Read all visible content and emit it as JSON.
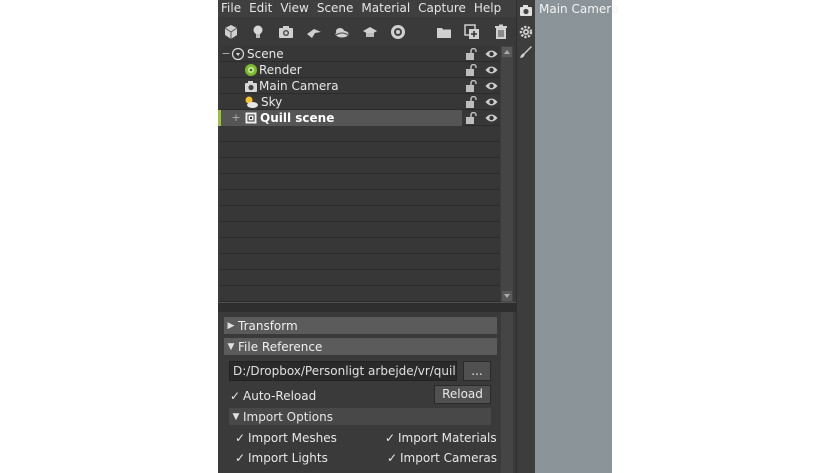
{
  "menu": [
    "File",
    "Edit",
    "View",
    "Scene",
    "Material",
    "Capture",
    "Help"
  ],
  "toolbar_icons": [
    "cube-icon",
    "light-bulb-icon",
    "camera-icon",
    "plane-icon",
    "sky-icon",
    "cap-icon",
    "disc-icon",
    "folder-icon",
    "new-layer-icon",
    "trash-icon"
  ],
  "tree": {
    "root": "Scene",
    "items": [
      "Render",
      "Main Camera",
      "Sky",
      "Quill scene"
    ]
  },
  "properties": {
    "transform_label": "Transform",
    "file_reference_label": "File Reference",
    "path_value": "D:/Dropbox/Personligt arbejde/vr/quillby.f",
    "browse_label": "...",
    "auto_reload_label": "Auto-Reload",
    "reload_label": "Reload",
    "import_options_label": "Import Options",
    "import_meshes": "Import Meshes",
    "import_materials": "Import Materials",
    "import_lights": "Import Lights",
    "import_cameras": "Import Cameras"
  },
  "viewport": {
    "title": "Main Camera"
  },
  "colors": {
    "panel": "#3a3a3a",
    "selected_row": "#555555",
    "active_marker": "#9bc23a",
    "viewport_bg": "#8b9499"
  }
}
